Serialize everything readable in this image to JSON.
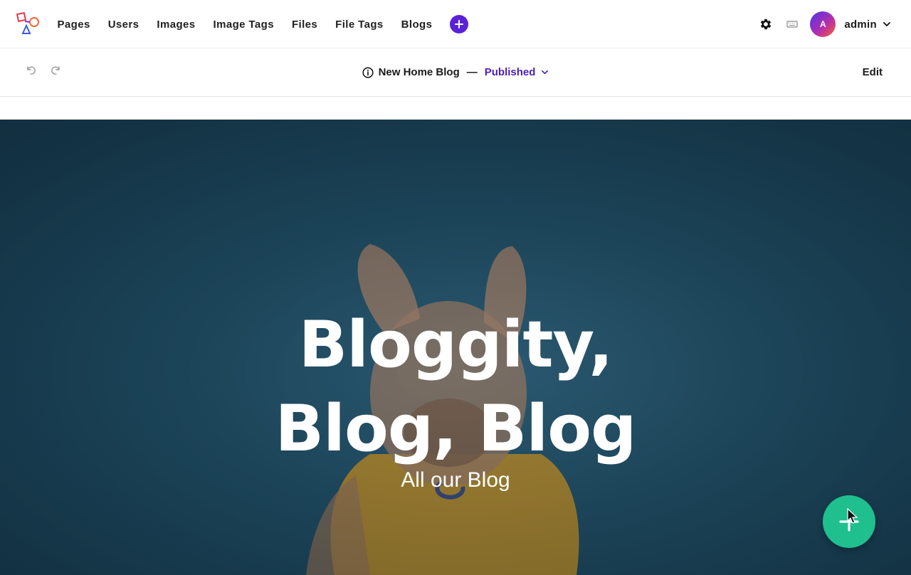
{
  "nav": {
    "items": [
      {
        "label": "Pages"
      },
      {
        "label": "Users"
      },
      {
        "label": "Images"
      },
      {
        "label": "Image Tags"
      },
      {
        "label": "Files"
      },
      {
        "label": "File Tags"
      },
      {
        "label": "Blogs"
      }
    ],
    "add_icon": "plus-icon"
  },
  "user": {
    "avatar_initial": "A",
    "name": "admin"
  },
  "editor": {
    "title": "New Home Blog",
    "separator": "—",
    "status": "Published",
    "edit_label": "Edit"
  },
  "hero": {
    "title_line1": "Bloggity,",
    "title_line2": "Blog, Blog",
    "subtitle": "All our Blog"
  },
  "colors": {
    "accent": "#5b21d6",
    "status_text": "#4a1fb8",
    "fab": "#1fc08e",
    "hero_bg": "#1f4c63"
  }
}
